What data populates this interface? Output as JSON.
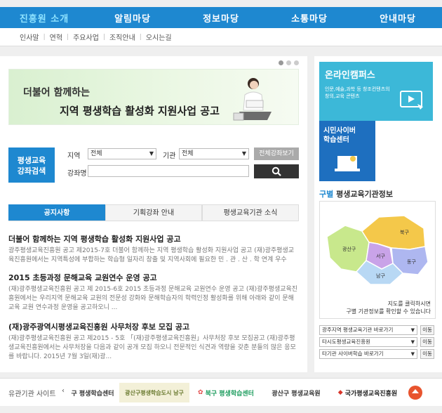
{
  "topnav": [
    "진흥원 소개",
    "알림마당",
    "정보마당",
    "소통마당",
    "안내마당"
  ],
  "subnav": [
    "인사말",
    "연혁",
    "주요사업",
    "조직안내",
    "오시는길"
  ],
  "banner": {
    "line1": "더불어 함께하는",
    "line2": "지역 평생학습 활성화 지원사업 공고"
  },
  "search": {
    "label_line1": "평생교육",
    "label_line2": "강좌검색",
    "region_label": "지역",
    "region_value": "전체",
    "org_label": "기관",
    "org_value": "전체",
    "all_button": "전체강좌보기",
    "lecture_label": "강좌명"
  },
  "tabs": [
    "공지사항",
    "기획강좌 안내",
    "평생교육기관 소식"
  ],
  "news": [
    {
      "title": "더불어 함께하는 지역 평생학습 활성화 지원사업 공고",
      "desc": "광주평생교육진흥원 공고 제2015-7호 더불어 함께하는 지역 평생학습 활성화 지원사업 공고 (재)광주평생교육진흥원에서는 지역특성에 부합하는 학습형 일자리 창출 및 지역사회에 필요한 민 . 관 . 산 . 학 연계 우수 특..."
    },
    {
      "title": "2015 초등과정 문해교육 교원연수 운영 공고",
      "desc": "(재)광주평생교육진흥원 공고 제 2015-6호 2015 초등과정 문해교육 교원연수 운영 공고 (재)광주평생교육진흥원에서는 우리지역 문해교육 교원의 전문성 강화와 문해학습자의 학력인정 활성화를 위해 아래와 같이 문해교육 교원 연수과정 운영을 공고하오니 ..."
    },
    {
      "title": "(재)광주광역시평생교육진흥원 사무처장 후보 모집 공고",
      "desc": "(재)광주평생교육진흥원 공고 제2015 - 5호 「(재)광주평생교육진흥원」사무처장 후보 모집공고 (재)광주평생교육진흥원에서는 사무처장을 다음과 같이 공개 모집 하오니 전문적인 식견과 역량을 갖춘 분들의 많은 응모를 바랍니다. 2015년 7월 3일(재)광..."
    }
  ],
  "right": {
    "online_title": "온라인캠퍼스",
    "online_desc": "인문,예술,과학 등 창조컨텐츠의 창의,교육 콘텐츠",
    "cyber_title_line1": "시민사이버",
    "cyber_title_line2": "학습센터",
    "region_title_blue": "구별",
    "region_title_rest": " 평생교육기관정보",
    "map_note_line1": "지도를 클릭하시면",
    "map_note_line2": "구별 기관정보를 확인할 수 있습니다",
    "districts": [
      "광산구",
      "북구",
      "서구",
      "동구",
      "남구"
    ],
    "dropdowns": [
      {
        "label": "광주지역 평생교육기관 바로가기",
        "go": "이동"
      },
      {
        "label": "타시도평생교육진흥원",
        "go": "이동"
      },
      {
        "label": "타기관 사이버학습 바로가기",
        "go": "이동"
      }
    ]
  },
  "bottom": {
    "label": "유관기관 사이트",
    "prev": "‹",
    "links": [
      "구 평생학습센터",
      "광산구평생학습도시 남구",
      "북구 평생학습센터",
      "광산구 평생교육원",
      "국가평생교육진흥원"
    ]
  },
  "colors": {
    "primary": "#1e88d0",
    "online_card": "#3cb8d8",
    "cyber_card": "#1e6fbf",
    "map_north": "#f4c84a",
    "map_west": "#c9a3e8",
    "map_east": "#aeb7f0",
    "map_south": "#b8d8f4",
    "map_gwangsan": "#c8e88c"
  }
}
